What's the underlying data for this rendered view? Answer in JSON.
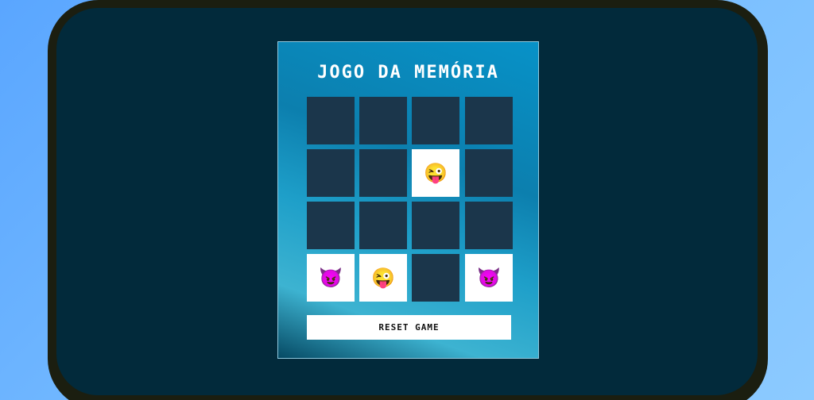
{
  "game": {
    "title": "JOGO DA MEMÓRIA",
    "reset_label": "RESET GAME"
  },
  "board": {
    "rows": 4,
    "cols": 4,
    "cards": [
      {
        "revealed": false,
        "emoji": ""
      },
      {
        "revealed": false,
        "emoji": ""
      },
      {
        "revealed": false,
        "emoji": ""
      },
      {
        "revealed": false,
        "emoji": ""
      },
      {
        "revealed": false,
        "emoji": ""
      },
      {
        "revealed": false,
        "emoji": ""
      },
      {
        "revealed": true,
        "emoji": "😜",
        "icon": "winking-face-with-tongue-icon"
      },
      {
        "revealed": false,
        "emoji": ""
      },
      {
        "revealed": false,
        "emoji": ""
      },
      {
        "revealed": false,
        "emoji": ""
      },
      {
        "revealed": false,
        "emoji": ""
      },
      {
        "revealed": false,
        "emoji": ""
      },
      {
        "revealed": true,
        "emoji": "😈",
        "icon": "smiling-devil-icon"
      },
      {
        "revealed": true,
        "emoji": "😜",
        "icon": "winking-face-with-tongue-icon"
      },
      {
        "revealed": false,
        "emoji": ""
      },
      {
        "revealed": true,
        "emoji": "😈",
        "icon": "smiling-devil-icon"
      }
    ]
  },
  "colors": {
    "card_back": "#1b364b",
    "card_front": "#ffffff",
    "screen_bg": "#022a3b",
    "panel_accent": "#0792c8"
  }
}
